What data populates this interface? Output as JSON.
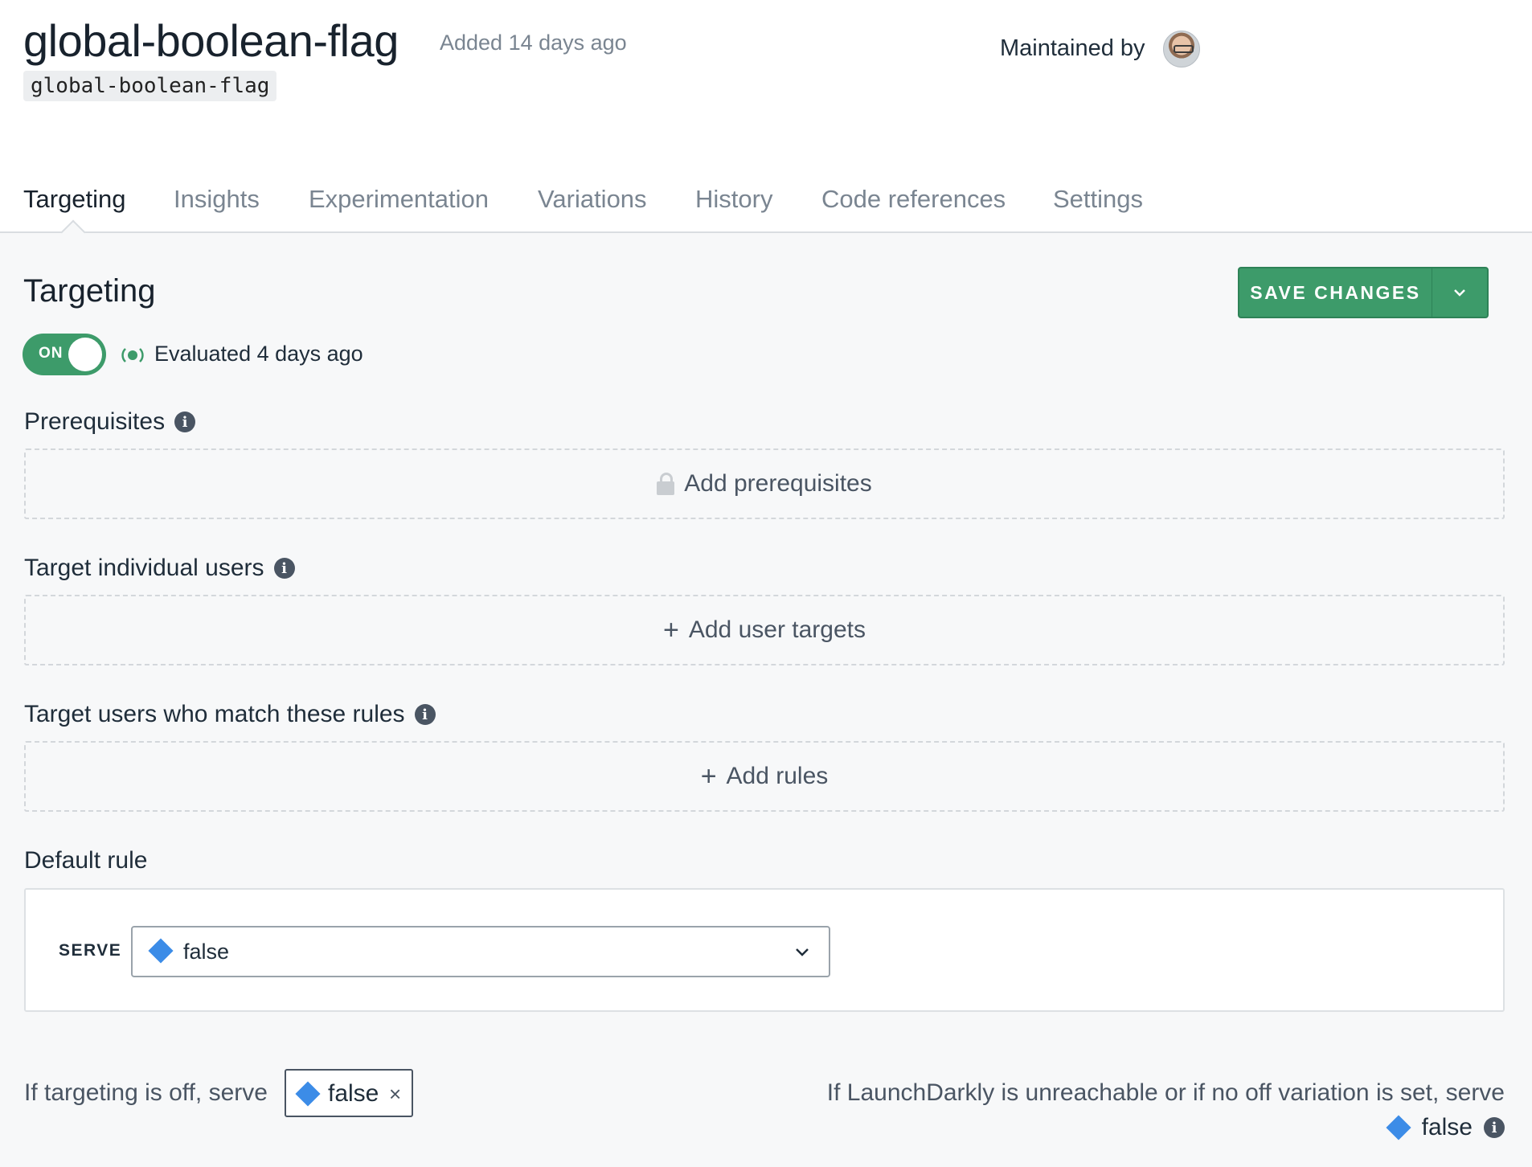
{
  "header": {
    "title": "global-boolean-flag",
    "added": "Added 14 days ago",
    "key": "global-boolean-flag",
    "maintained_by": "Maintained by"
  },
  "tabs": [
    {
      "label": "Targeting",
      "active": true
    },
    {
      "label": "Insights"
    },
    {
      "label": "Experimentation"
    },
    {
      "label": "Variations"
    },
    {
      "label": "History"
    },
    {
      "label": "Code references"
    },
    {
      "label": "Settings"
    }
  ],
  "targeting": {
    "title": "Targeting",
    "save_label": "SAVE CHANGES",
    "toggle_label": "ON",
    "toggle_on": true,
    "evaluated": "Evaluated 4 days ago"
  },
  "prerequisites": {
    "label": "Prerequisites",
    "action": "Add prerequisites"
  },
  "individual_targets": {
    "label": "Target individual users",
    "action": "Add user targets"
  },
  "rules": {
    "label": "Target users who match these rules",
    "action": "Add rules"
  },
  "default_rule": {
    "label": "Default rule",
    "serve_label": "SERVE",
    "value": "false"
  },
  "off_variation": {
    "text": "If targeting is off, serve",
    "value": "false",
    "close": "×"
  },
  "fallback": {
    "text": "If LaunchDarkly is unreachable or if no off variation is set, serve",
    "value": "false"
  },
  "colors": {
    "accent_green": "#3d9b6a",
    "variation_blue": "#3c8ce7"
  }
}
